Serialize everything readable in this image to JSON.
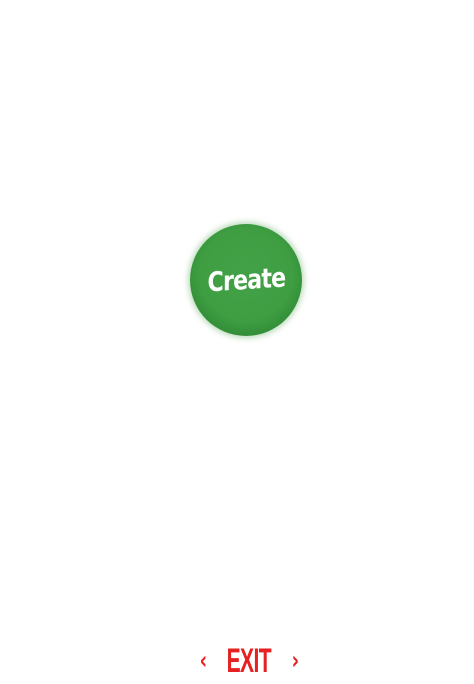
{
  "create_button": {
    "label": "Create"
  },
  "exit": {
    "left_icon": "chevron-left-icon",
    "label": "EXIT",
    "right_icon": "chevron-right-icon"
  },
  "colors": {
    "background": "#ffffff",
    "create_button": "#3f9e42",
    "exit_text": "#e52121"
  }
}
